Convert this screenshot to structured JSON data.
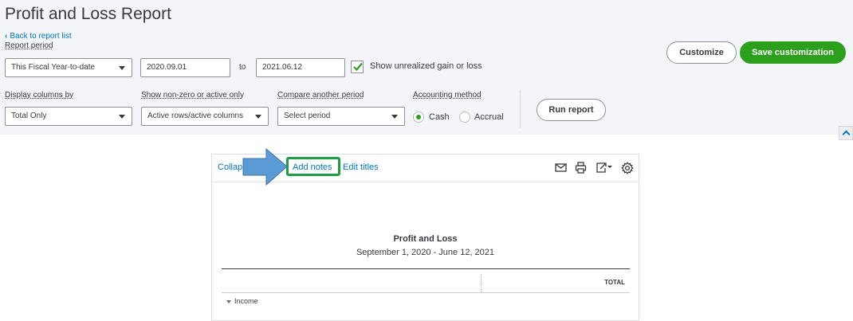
{
  "page": {
    "title": "Profit and Loss Report",
    "back_link": "Back to report list"
  },
  "filters": {
    "report_period_label": "Report period",
    "period_value": "This Fiscal Year-to-date",
    "date_from": "2020.09.01",
    "to_label": "to",
    "date_to": "2021.06.12",
    "unrealized_checked": true,
    "unrealized_label": "Show unrealized gain or loss",
    "display_columns_label": "Display columns by",
    "display_columns_value": "Total Only",
    "nonzero_label": "Show non-zero or active only",
    "nonzero_value": "Active rows/active columns",
    "compare_label": "Compare another period",
    "compare_value": "Select period",
    "accounting_label": "Accounting method",
    "accounting_options": [
      "Cash",
      "Accrual"
    ],
    "accounting_selected": "Cash"
  },
  "buttons": {
    "customize": "Customize",
    "save_customization": "Save customization",
    "run_report": "Run report"
  },
  "report_toolbar": {
    "collapse": "Collap",
    "add_notes": "Add notes",
    "edit_titles": "Edit titles",
    "icons": [
      "email-icon",
      "print-icon",
      "export-icon",
      "settings-gear-icon"
    ]
  },
  "report": {
    "title": "Profit and Loss",
    "date_range": "September 1, 2020 - June 12, 2021",
    "column_header": "TOTAL",
    "rows": [
      {
        "label": "Income",
        "expanded": true
      }
    ]
  },
  "colors": {
    "brand_green": "#2ca01c",
    "link_blue": "#0077c5",
    "highlight_green": "#1e9e44",
    "arrow_blue": "#5b9bd5",
    "header_bg": "#f4f5f8"
  }
}
